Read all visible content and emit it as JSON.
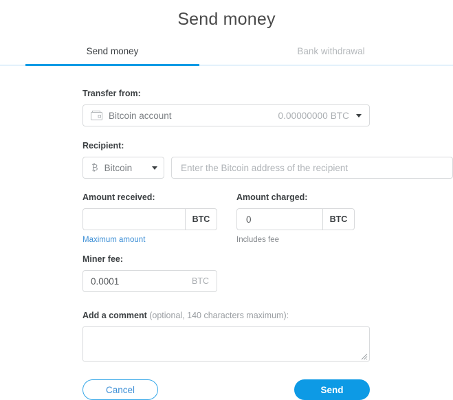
{
  "page": {
    "title": "Send money"
  },
  "tabs": [
    {
      "id": "send-money",
      "label": "Send money",
      "active": true
    },
    {
      "id": "bank-withdrawal",
      "label": "Bank withdrawal",
      "active": false
    }
  ],
  "form": {
    "transfer_from": {
      "label": "Transfer from:",
      "icon": "wallet-icon",
      "account_name": "Bitcoin account",
      "balance": "0.00000000 BTC",
      "caret": "chevron-down-icon"
    },
    "recipient": {
      "label": "Recipient:",
      "currency_icon": "bitcoin-icon",
      "currency_glyph": "₿",
      "currency": "Bitcoin",
      "address_value": "",
      "address_placeholder": "Enter the Bitcoin address of the recipient"
    },
    "amount_received": {
      "label": "Amount received:",
      "value": "",
      "placeholder": "",
      "unit": "BTC",
      "hint": "Maximum amount"
    },
    "amount_charged": {
      "label": "Amount charged:",
      "value": "0",
      "placeholder": "",
      "unit": "BTC",
      "hint": "Includes fee"
    },
    "miner_fee": {
      "label": "Miner fee:",
      "value": "0.0001",
      "unit": "BTC"
    },
    "comment": {
      "label_bold": "Add a comment",
      "label_note": " (optional, 140 characters maximum):",
      "value": "",
      "placeholder": ""
    },
    "buttons": {
      "cancel": "Cancel",
      "send": "Send"
    }
  },
  "colors": {
    "accent_blue": "#0d9ae5",
    "link_blue": "#3d8fd6",
    "tab_baseline": "#e3f1fb",
    "border_grey": "#d8dadc",
    "muted_text": "#9a9ea2"
  }
}
